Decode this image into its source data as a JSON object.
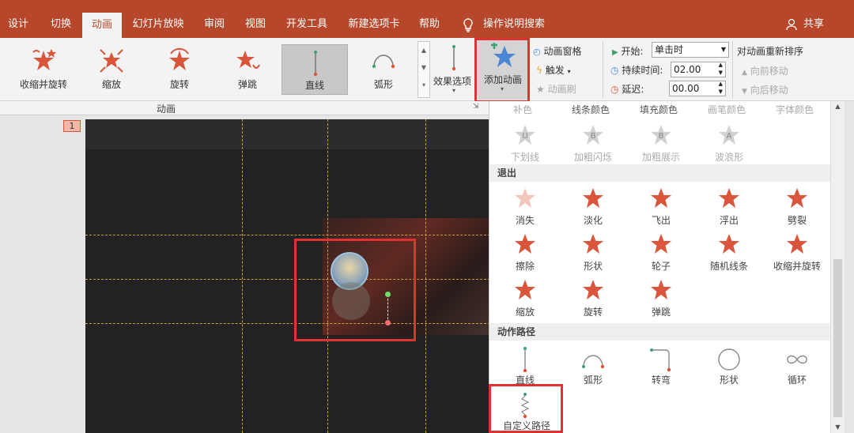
{
  "tabs": [
    {
      "label": "设计"
    },
    {
      "label": "切换"
    },
    {
      "label": "动画"
    },
    {
      "label": "幻灯片放映"
    },
    {
      "label": "审阅"
    },
    {
      "label": "视图"
    },
    {
      "label": "开发工具"
    },
    {
      "label": "新建选项卡"
    },
    {
      "label": "帮助"
    }
  ],
  "tell_me": "操作说明搜索",
  "share": "共享",
  "gallery": [
    {
      "label": "收缩并旋转",
      "icon": "shrink-turn-icon"
    },
    {
      "label": "缩放",
      "icon": "zoom-icon"
    },
    {
      "label": "旋转",
      "icon": "spin-icon"
    },
    {
      "label": "弹跳",
      "icon": "bounce-icon"
    },
    {
      "label": "直线",
      "icon": "line-path-icon"
    },
    {
      "label": "弧形",
      "icon": "arc-path-icon"
    }
  ],
  "effect_options": "效果选项",
  "add_animation": "添加动画",
  "animation_pane": "动画窗格",
  "trigger": "触发",
  "animation_painter": "动画刷",
  "start_label": "开始:",
  "start_value": "单击时",
  "duration_label": "持续时间:",
  "duration_value": "02.00",
  "delay_label": "延迟:",
  "delay_value": "00.00",
  "reorder_title": "对动画重新排序",
  "move_earlier": "向前移动",
  "move_later": "向后移动",
  "group_label": "动画",
  "slide_number": "1",
  "dropdown": {
    "top_row": [
      "补色",
      "线条颜色",
      "填充颜色",
      "画笔颜色",
      "字体颜色"
    ],
    "emphasis_row": [
      {
        "label": "下划线",
        "letter": "U"
      },
      {
        "label": "加粗闪烁",
        "letter": "B"
      },
      {
        "label": "加粗展示",
        "letter": "B"
      },
      {
        "label": "波浪形",
        "letter": "A"
      }
    ],
    "exit_header": "退出",
    "exit_items": [
      "消失",
      "淡化",
      "飞出",
      "浮出",
      "劈裂",
      "擦除",
      "形状",
      "轮子",
      "随机线条",
      "收缩并旋转",
      "缩放",
      "旋转",
      "弹跳"
    ],
    "path_header": "动作路径",
    "path_items": [
      "直线",
      "弧形",
      "转弯",
      "形状",
      "循环",
      "自定义路径"
    ]
  },
  "colors": {
    "accent": "#b7472a",
    "star": "#d9553b",
    "highlight": "#e03232"
  }
}
